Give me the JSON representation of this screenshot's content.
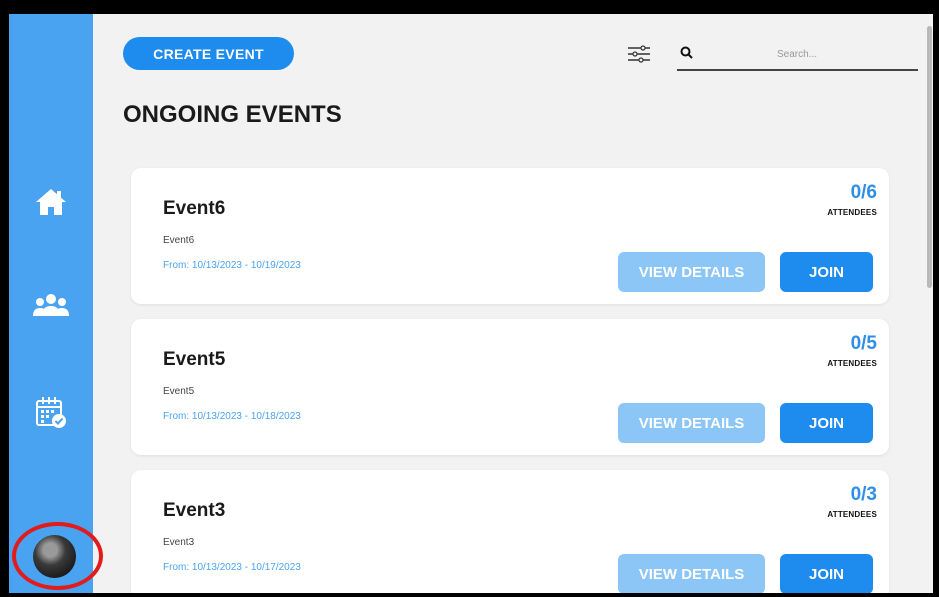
{
  "toolbar": {
    "create_label": "CREATE EVENT",
    "search_placeholder": "Search..."
  },
  "section": {
    "title": "ONGOING EVENTS"
  },
  "sidebar": {
    "items": [
      {
        "icon": "home-icon"
      },
      {
        "icon": "users-icon"
      },
      {
        "icon": "calendar-check-icon"
      }
    ],
    "avatar": "user-avatar"
  },
  "events": [
    {
      "title": "Event6",
      "description": "Event6",
      "dates": "From: 10/13/2023 - 10/19/2023",
      "count": "0/6",
      "attendees_label": "ATTENDEES",
      "view_label": "VIEW DETAILS",
      "join_label": "JOIN"
    },
    {
      "title": "Event5",
      "description": "Event5",
      "dates": "From: 10/13/2023 - 10/18/2023",
      "count": "0/5",
      "attendees_label": "ATTENDEES",
      "view_label": "VIEW DETAILS",
      "join_label": "JOIN"
    },
    {
      "title": "Event3",
      "description": "Event3",
      "dates": "From: 10/13/2023 - 10/17/2023",
      "count": "0/3",
      "attendees_label": "ATTENDEES",
      "view_label": "VIEW DETAILS",
      "join_label": "JOIN"
    }
  ],
  "colors": {
    "sidebar": "#4aa3f0",
    "primary": "#1e8bef",
    "secondary_button": "#8cc6f6",
    "highlight_ring": "#e21b1b"
  }
}
